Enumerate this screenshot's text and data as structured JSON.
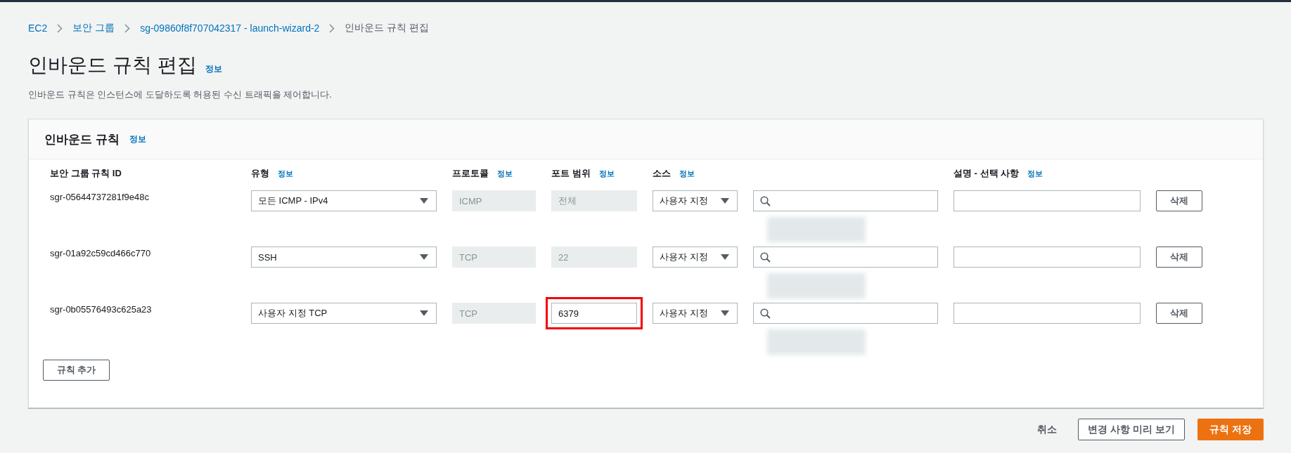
{
  "breadcrumbs": [
    {
      "label": "EC2",
      "link": true
    },
    {
      "label": "보안 그룹",
      "link": true
    },
    {
      "label": "sg-09860f8f707042317 - launch-wizard-2",
      "link": true
    },
    {
      "label": "인바운드 규칙 편집",
      "link": false
    }
  ],
  "page": {
    "title": "인바운드 규칙 편집",
    "info": "정보",
    "description": "인바운드 규칙은 인스턴스에 도달하도록 허용된 수신 트래픽을 제어합니다."
  },
  "panel": {
    "title": "인바운드 규칙",
    "info": "정보",
    "columns": [
      {
        "label": "보안 그룹 규칙 ID"
      },
      {
        "label": "유형",
        "info": "정보"
      },
      {
        "label": "프로토콜",
        "info": "정보"
      },
      {
        "label": "포트 범위",
        "info": "정보"
      },
      {
        "label": "소스",
        "info": "정보"
      },
      {},
      {
        "label": "설명 - 선택 사항",
        "info": "정보"
      }
    ],
    "rows": [
      {
        "id": "sgr-05644737281f9e48c",
        "type": "모든 ICMP - IPv4",
        "protocol": "ICMP",
        "port": "전체",
        "port_disabled": true,
        "highlighted": false,
        "source": "사용자 지정",
        "delete": "삭제"
      },
      {
        "id": "sgr-01a92c59cd466c770",
        "type": "SSH",
        "protocol": "TCP",
        "port": "22",
        "port_disabled": true,
        "highlighted": false,
        "source": "사용자 지정",
        "delete": "삭제"
      },
      {
        "id": "sgr-0b05576493c625a23",
        "type": "사용자 지정 TCP",
        "protocol": "TCP",
        "port": "6379",
        "port_disabled": false,
        "highlighted": true,
        "source": "사용자 지정",
        "delete": "삭제"
      }
    ],
    "add_button": "규칙 추가"
  },
  "footer": {
    "cancel": "취소",
    "preview": "변경 사항 미리 보기",
    "save": "규칙 저장"
  }
}
